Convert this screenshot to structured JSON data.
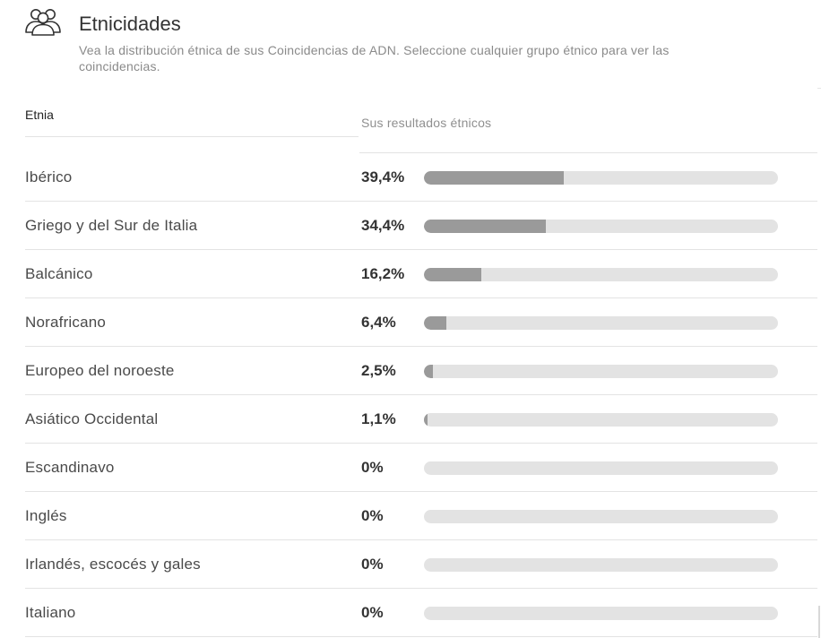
{
  "header": {
    "icon": "users-group-icon",
    "title": "Etnicidades",
    "subtitle": "Vea la distribución étnica de sus Coincidencias de ADN. Seleccione cualquier grupo étnico para ver las coincidencias."
  },
  "table": {
    "col_ethnicity": "Etnia",
    "col_results": "Sus resultados étnicos",
    "rows": [
      {
        "name": "Ibérico",
        "percent_label": "39,4%",
        "value": 39.4
      },
      {
        "name": "Griego y del Sur de Italia",
        "percent_label": "34,4%",
        "value": 34.4
      },
      {
        "name": "Balcánico",
        "percent_label": "16,2%",
        "value": 16.2
      },
      {
        "name": "Norafricano",
        "percent_label": "6,4%",
        "value": 6.4
      },
      {
        "name": "Europeo del noroeste",
        "percent_label": "2,5%",
        "value": 2.5
      },
      {
        "name": "Asiático Occidental",
        "percent_label": "1,1%",
        "value": 1.1
      },
      {
        "name": "Escandinavo",
        "percent_label": "0%",
        "value": 0
      },
      {
        "name": "Inglés",
        "percent_label": "0%",
        "value": 0
      },
      {
        "name": "Irlandés, escocés y gales",
        "percent_label": "0%",
        "value": 0
      },
      {
        "name": "Italiano",
        "percent_label": "0%",
        "value": 0
      }
    ]
  },
  "colors": {
    "bar_fill": "#9a9a9a",
    "bar_track": "#e3e3e3"
  }
}
